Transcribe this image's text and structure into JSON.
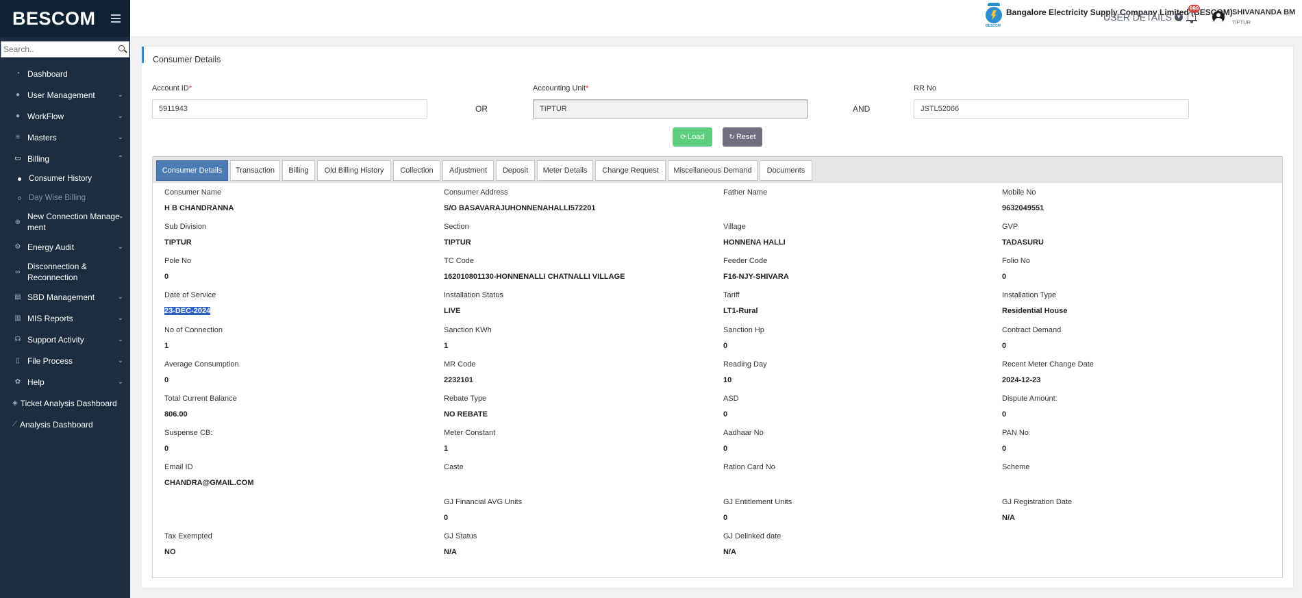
{
  "sidebar": {
    "brand": "BESCOM",
    "search_placeholder": "Search..",
    "items": [
      {
        "label": "Dashboard",
        "icon": "dashboard-icon"
      },
      {
        "label": "User Management",
        "icon": "user-icon"
      },
      {
        "label": "WorkFlow",
        "icon": "user-icon"
      },
      {
        "label": "Masters",
        "icon": "list-icon"
      },
      {
        "label": "Billing",
        "icon": "monitor-icon"
      },
      {
        "label": "New Connection Manage-ment",
        "icon": "plus-circle-icon"
      },
      {
        "label": "Energy Audit",
        "icon": "gears-icon"
      },
      {
        "label": "Disconnection & Reconnection",
        "icon": "link-icon"
      },
      {
        "label": "SBD Management",
        "icon": "server-icon"
      },
      {
        "label": "MIS Reports",
        "icon": "chart-icon"
      },
      {
        "label": "Support Activity",
        "icon": "headset-icon"
      },
      {
        "label": "File Process",
        "icon": "file-icon"
      },
      {
        "label": "Help",
        "icon": "gear-icon"
      }
    ],
    "billing_sub": [
      {
        "label": "Consumer History"
      },
      {
        "label": "Day Wise Billing"
      }
    ],
    "extra": [
      {
        "label": "Ticket Analysis Dashboard",
        "icon": "diamond-icon"
      },
      {
        "label": "Analysis Dashboard",
        "icon": "line-chart-icon"
      }
    ]
  },
  "header": {
    "logo_text": "BESCOM",
    "company": "Bangalore Electricity Supply Company Limited (BESCOM)",
    "user_details": "USER DETAILS",
    "notif_count": "999",
    "user_name": "SHIVANANDA BM",
    "user_location": "TIPTUR"
  },
  "page": {
    "title": "Consumer Details",
    "account_id_label": "Account ID",
    "account_id_value": "5911943",
    "or_text": "OR",
    "accounting_unit_label": "Accounting Unit",
    "accounting_unit_value": "TIPTUR",
    "and_text": "AND",
    "rr_no_label": "RR No",
    "rr_no_value": "JSTL52066",
    "load_label": "Load",
    "reset_label": "Reset",
    "required_mark": "*"
  },
  "tabs": [
    "Consumer Details",
    "Transaction",
    "Billing",
    "Old Billing History",
    "Collection",
    "Adjustment",
    "Deposit",
    "Meter Details",
    "Change Request",
    "Miscellaneous Demand",
    "Documents"
  ],
  "details": {
    "consumer_name": {
      "label": "Consumer Name",
      "value": "H B CHANDRANNA"
    },
    "consumer_address": {
      "label": "Consumer Address",
      "value": "S/O BASAVARAJUHONNENAHALLI572201"
    },
    "father_name": {
      "label": "Father Name",
      "value": ""
    },
    "mobile_no": {
      "label": "Mobile No",
      "value": "9632049551"
    },
    "sub_division": {
      "label": "Sub Division",
      "value": "TIPTUR"
    },
    "section": {
      "label": "Section",
      "value": "TIPTUR"
    },
    "village": {
      "label": "Village",
      "value": "HONNENA HALLI"
    },
    "gvp": {
      "label": "GVP",
      "value": "TADASURU"
    },
    "pole_no": {
      "label": "Pole No",
      "value": "0"
    },
    "tc_code": {
      "label": "TC Code",
      "value": "162010801130-HONNENALLI CHATNALLI VILLAGE"
    },
    "feeder_code": {
      "label": "Feeder Code",
      "value": "F16-NJY-SHIVARA"
    },
    "folio_no": {
      "label": "Folio No",
      "value": "0"
    },
    "date_of_service": {
      "label": "Date of Service",
      "value": "23-DEC-2024"
    },
    "installation_status": {
      "label": "Installation Status",
      "value": "LIVE"
    },
    "tariff": {
      "label": "Tariff",
      "value": "LT1-Rural"
    },
    "installation_type": {
      "label": "Installation Type",
      "value": "Residential House"
    },
    "no_of_connection": {
      "label": "No of Connection",
      "value": "1"
    },
    "sanction_kwh": {
      "label": "Sanction KWh",
      "value": "1"
    },
    "sanction_hp": {
      "label": "Sanction Hp",
      "value": "0"
    },
    "contract_demand": {
      "label": "Contract Demand",
      "value": "0"
    },
    "average_consumption": {
      "label": "Average Consumption",
      "value": "0"
    },
    "mr_code": {
      "label": "MR Code",
      "value": "2232101"
    },
    "reading_day": {
      "label": "Reading Day",
      "value": "10"
    },
    "recent_meter_change_date": {
      "label": "Recent Meter Change Date",
      "value": "2024-12-23"
    },
    "total_current_balance": {
      "label": "Total Current Balance",
      "value": "806.00"
    },
    "rebate_type": {
      "label": "Rebate Type",
      "value": "NO REBATE"
    },
    "asd": {
      "label": "ASD",
      "value": "0"
    },
    "dispute_amount": {
      "label": "Dispute Amount:",
      "value": "0"
    },
    "suspense_cb": {
      "label": "Suspense CB:",
      "value": "0"
    },
    "meter_constant": {
      "label": "Meter Constant",
      "value": "1"
    },
    "aadhaar_no": {
      "label": "Aadhaar No",
      "value": "0"
    },
    "pan_no": {
      "label": "PAN No",
      "value": "0"
    },
    "email_id": {
      "label": "Email ID",
      "value": "CHANDRA@GMAIL.COM"
    },
    "caste": {
      "label": "Caste",
      "value": ""
    },
    "ration_card_no": {
      "label": "Ration Card No",
      "value": ""
    },
    "scheme": {
      "label": "Scheme",
      "value": ""
    },
    "gj_financial_avg_units": {
      "label": "GJ Financial AVG Units",
      "value": "0"
    },
    "gj_entitlement_units": {
      "label": "GJ Entitlement Units",
      "value": "0"
    },
    "gj_registration_date": {
      "label": "GJ Registration Date",
      "value": "N/A"
    },
    "tax_exempted": {
      "label": "Tax Exempted",
      "value": "NO"
    },
    "gj_status": {
      "label": "GJ Status",
      "value": "N/A"
    },
    "gj_delinked_date": {
      "label": "GJ Delinked date",
      "value": "N/A"
    }
  },
  "colors": {
    "sidebar_bg": "#1c2d3f",
    "active_tab": "#4d7bb4",
    "load_button": "#5dd07f",
    "reset_button": "#6f6f80",
    "badge": "#e03b3b"
  }
}
